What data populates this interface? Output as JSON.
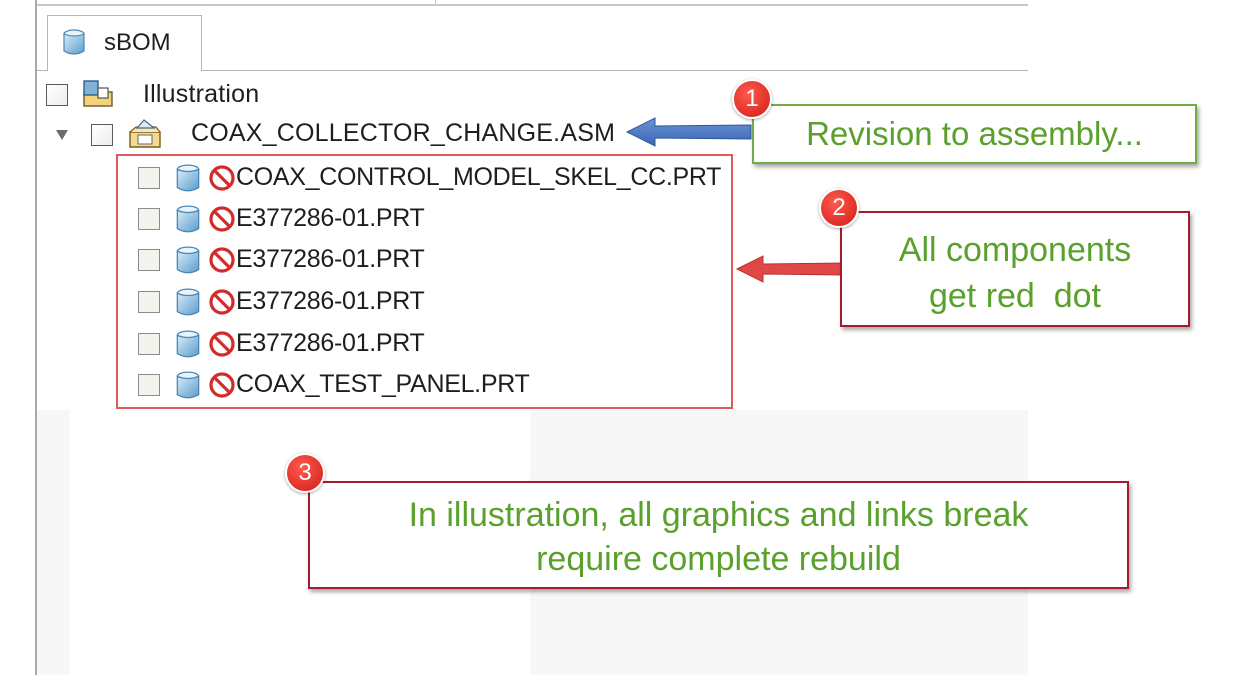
{
  "tab": {
    "label": "sBOM",
    "icon": "part-cube-icon"
  },
  "tree": {
    "root_illustration": {
      "label": "Illustration",
      "icon": "illustration-icon"
    },
    "assembly": {
      "label": "COAX_COLLECTOR_CHANGE.ASM",
      "icon": "assembly-icon",
      "expanded": true
    },
    "components": [
      {
        "label": "COAX_CONTROL_MODEL_SKEL_CC.PRT",
        "icon": "part-cube-icon",
        "status": "broken-link-icon"
      },
      {
        "label": "E377286-01.PRT",
        "icon": "part-cube-icon",
        "status": "broken-link-icon"
      },
      {
        "label": "E377286-01.PRT",
        "icon": "part-cube-icon",
        "status": "broken-link-icon"
      },
      {
        "label": "E377286-01.PRT",
        "icon": "part-cube-icon",
        "status": "broken-link-icon"
      },
      {
        "label": "E377286-01.PRT",
        "icon": "part-cube-icon",
        "status": "broken-link-icon"
      },
      {
        "label": "COAX_TEST_PANEL.PRT",
        "icon": "part-cube-icon",
        "status": "broken-link-icon"
      }
    ]
  },
  "callouts": [
    {
      "number": "1",
      "text": "Revision to assembly..."
    },
    {
      "number": "2",
      "line1": "All components",
      "line2": "get red  dot"
    },
    {
      "number": "3",
      "line1": "In illustration, all graphics and links break",
      "line2": "require complete rebuild"
    }
  ],
  "colors": {
    "callout_text": "#5aa02c",
    "callout1_border": "#70ad47",
    "callout_border_red": "#a31c2b",
    "badge": "#e3342b",
    "arrow_blue": "#4472c4",
    "arrow_red": "#e04848",
    "selection_frame": "#e05a5a"
  }
}
